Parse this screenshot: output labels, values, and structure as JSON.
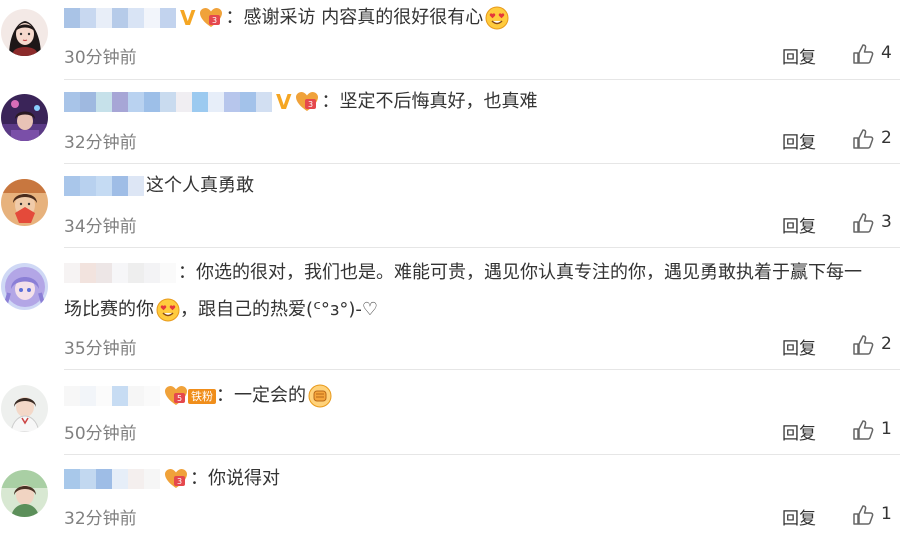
{
  "comments": [
    {
      "text": "：感谢采访 内容真的很好很有心",
      "text2": "",
      "time": "30分钟前",
      "reply_label": "回复",
      "likes": "4",
      "verified": "V",
      "fan_label": "",
      "end_emoji": "heart-eyes-emoji-icon"
    },
    {
      "text": "：坚定不后悔真好，也真难",
      "text2": "",
      "time": "32分钟前",
      "reply_label": "回复",
      "likes": "2",
      "verified": "V",
      "fan_label": "",
      "end_emoji": ""
    },
    {
      "text": "这个人真勇敢",
      "text2": "",
      "time": "34分钟前",
      "reply_label": "回复",
      "likes": "3",
      "verified": "",
      "fan_label": "",
      "end_emoji": ""
    },
    {
      "text": "：你选的很对，我们也是。难能可贵，遇见你认真专注的你，遇见勇敢执着于赢下每一",
      "text2a": "场比赛的你",
      "text2b": "，跟自己的热爱(ᑦ°з°)-♡",
      "time": "35分钟前",
      "reply_label": "回复",
      "likes": "2",
      "verified": "",
      "fan_label": "",
      "end_emoji": "heart-eyes-emoji-icon"
    },
    {
      "text": "：一定会的",
      "text2": "",
      "time": "50分钟前",
      "reply_label": "回复",
      "likes": "1",
      "verified": "",
      "fan_label": "铁粉",
      "end_emoji": "fist-emoji-icon"
    },
    {
      "text": "：你说得对",
      "text2": "",
      "time": "32分钟前",
      "reply_label": "回复",
      "likes": "1",
      "verified": "",
      "fan_label": "",
      "end_emoji": ""
    }
  ],
  "colors": {
    "verified": "#f5a623",
    "time": "#808080",
    "text": "#333333",
    "divider": "#e6e6e6",
    "fan_badge": "#f08e1b"
  }
}
